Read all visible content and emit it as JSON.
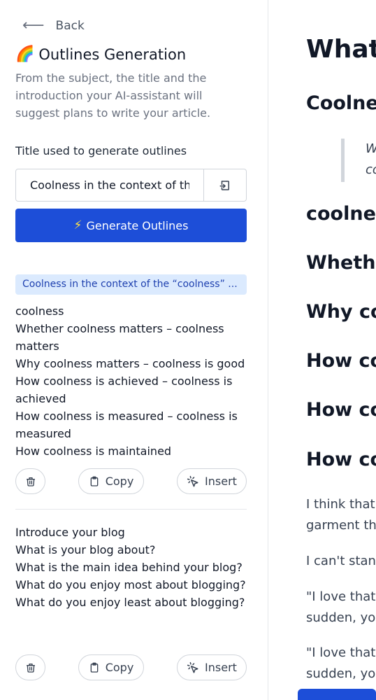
{
  "sidebar": {
    "back_label": "Back",
    "title_emoji": "🌈",
    "title": "Outlines Generation",
    "description": "From the subject, the title and the introduction your AI-assistant will suggest plans to write your article.",
    "field_label": "Title used to generate outlines",
    "title_input_value": "Coolness in the context of th",
    "generate_label": "Generate Outlines",
    "badge": "Coolness in the context of the “coolness” ...",
    "outlines": [
      {
        "items": [
          "coolness",
          "Whether coolness matters – coolness matters",
          "Why coolness matters – coolness is good",
          "How coolness is achieved – coolness is achieved",
          "How coolness is measured – coolness is measured",
          "How coolness is maintained"
        ],
        "copy_label": "Copy",
        "insert_label": "Insert"
      },
      {
        "items": [
          "Introduce your blog",
          "What is your blog about?",
          "What is the main idea behind your blog?",
          "What do you enjoy most about blogging?",
          "What do you enjoy least about blogging?"
        ],
        "copy_label": "Copy",
        "insert_label": "Insert"
      }
    ]
  },
  "main": {
    "h1": "What",
    "h2_1": "Coolne",
    "quote_line1": "W",
    "quote_line2": "co",
    "h2_2": "coolnes",
    "h2_3": "Whethe",
    "h2_4": "Why co",
    "h2_5": "How co",
    "h2_6": "How co",
    "h2_7": "How co",
    "p1_line1": "I think that",
    "p1_line2": "garment th",
    "p2": "I can't stan",
    "p3_line1": "\"I love that",
    "p3_line2": "sudden, yo",
    "p4_line1": "\"I love that",
    "p4_line2": "sudden, yo"
  },
  "colors": {
    "primary": "#1d4ed8",
    "badge_bg": "#dbeafe",
    "badge_text": "#1e40af"
  }
}
